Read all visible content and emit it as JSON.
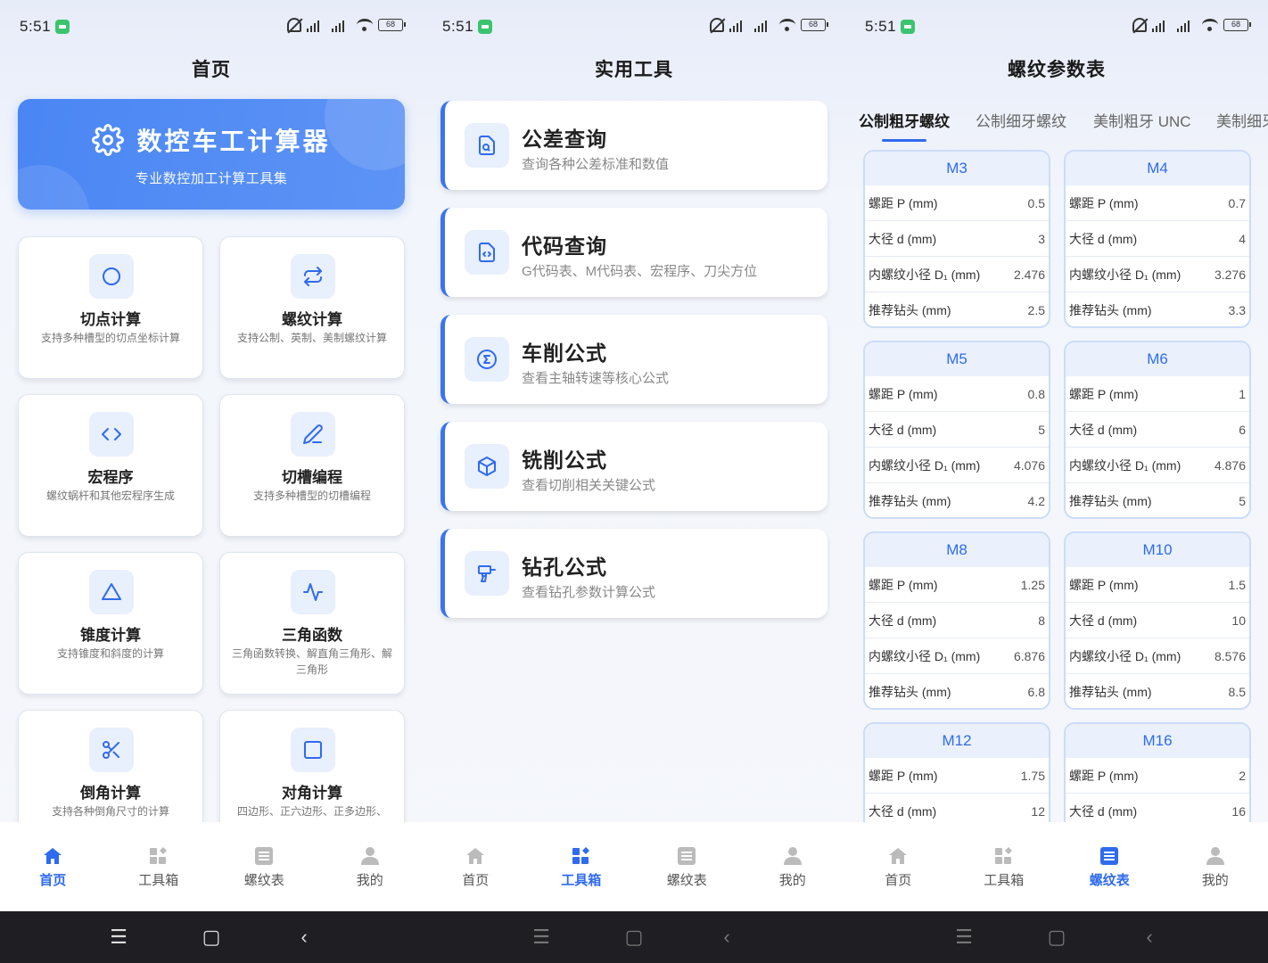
{
  "status": {
    "time": "5:51",
    "battery": "68"
  },
  "phone1": {
    "title": "首页",
    "hero_title": "数控车工计算器",
    "hero_subtitle": "专业数控加工计算工具集",
    "tiles": [
      {
        "name": "切点计算",
        "desc": "支持多种槽型的切点坐标计算",
        "icon": "circle-icon"
      },
      {
        "name": "螺纹计算",
        "desc": "支持公制、英制、美制螺纹计算",
        "icon": "swap-icon"
      },
      {
        "name": "宏程序",
        "desc": "螺纹蜗杆和其他宏程序生成",
        "icon": "code-icon"
      },
      {
        "name": "切槽编程",
        "desc": "支持多种槽型的切槽编程",
        "icon": "pen-icon"
      },
      {
        "name": "锥度计算",
        "desc": "支持锥度和斜度的计算",
        "icon": "triangle-icon"
      },
      {
        "name": "三角函数",
        "desc": "三角函数转换、解直角三角形、解三角形",
        "icon": "pulse-icon"
      },
      {
        "name": "倒角计算",
        "desc": "支持各种倒角尺寸的计算",
        "icon": "scissors-icon"
      },
      {
        "name": "对角计算",
        "desc": "四边形、正六边形、正多边形、",
        "icon": "square-icon"
      }
    ]
  },
  "phone2": {
    "title": "实用工具",
    "tools": [
      {
        "name": "公差查询",
        "desc": "查询各种公差标准和数值",
        "icon": "file-search-icon"
      },
      {
        "name": "代码查询",
        "desc": "G代码表、M代码表、宏程序、刀尖方位",
        "icon": "file-code-icon"
      },
      {
        "name": "车削公式",
        "desc": "查看主轴转速等核心公式",
        "icon": "sigma-icon"
      },
      {
        "name": "铣削公式",
        "desc": "查看切削相关关键公式",
        "icon": "cube-icon"
      },
      {
        "name": "钻孔公式",
        "desc": "查看钻孔参数计算公式",
        "icon": "drill-icon"
      }
    ]
  },
  "phone3": {
    "title": "螺纹参数表",
    "tabs": [
      "公制粗牙螺纹",
      "公制细牙螺纹",
      "美制粗牙 UNC",
      "美制细牙"
    ],
    "row_labels": [
      "螺距 P (mm)",
      "大径 d (mm)",
      "内螺纹小径 D₁ (mm)",
      "推荐钻头 (mm)"
    ],
    "threads": [
      {
        "name": "M3",
        "values": [
          "0.5",
          "3",
          "2.476",
          "2.5"
        ]
      },
      {
        "name": "M4",
        "values": [
          "0.7",
          "4",
          "3.276",
          "3.3"
        ]
      },
      {
        "name": "M5",
        "values": [
          "0.8",
          "5",
          "4.076",
          "4.2"
        ]
      },
      {
        "name": "M6",
        "values": [
          "1",
          "6",
          "4.876",
          "5"
        ]
      },
      {
        "name": "M8",
        "values": [
          "1.25",
          "8",
          "6.876",
          "6.8"
        ]
      },
      {
        "name": "M10",
        "values": [
          "1.5",
          "10",
          "8.576",
          "8.5"
        ]
      },
      {
        "name": "M12",
        "values": [
          "1.75",
          "12",
          "",
          ""
        ]
      },
      {
        "name": "M16",
        "values": [
          "2",
          "16",
          "",
          ""
        ]
      }
    ]
  },
  "nav": {
    "items": [
      {
        "label": "首页",
        "icon": "home-icon"
      },
      {
        "label": "工具箱",
        "icon": "toolbox-icon"
      },
      {
        "label": "螺纹表",
        "icon": "table-icon"
      },
      {
        "label": "我的",
        "icon": "user-icon"
      }
    ],
    "active": [
      "首页",
      "工具箱",
      "螺纹表"
    ]
  },
  "colors": {
    "accent": "#2f6bef",
    "hero": "#4a86f4",
    "tile_icon_bg": "#e8effd"
  }
}
